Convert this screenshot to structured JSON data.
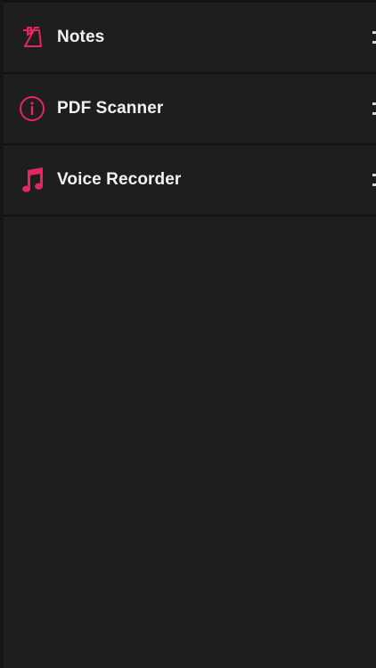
{
  "theme": {
    "accent": "#e8265e",
    "background": "#1e1e1e",
    "divider": "#121212",
    "text": "#f2f2f2"
  },
  "menu": {
    "items": [
      {
        "label": "Notes",
        "icon": "notes-icon"
      },
      {
        "label": "PDF Scanner",
        "icon": "info-icon"
      },
      {
        "label": "Voice Recorder",
        "icon": "music-note-icon"
      }
    ]
  }
}
